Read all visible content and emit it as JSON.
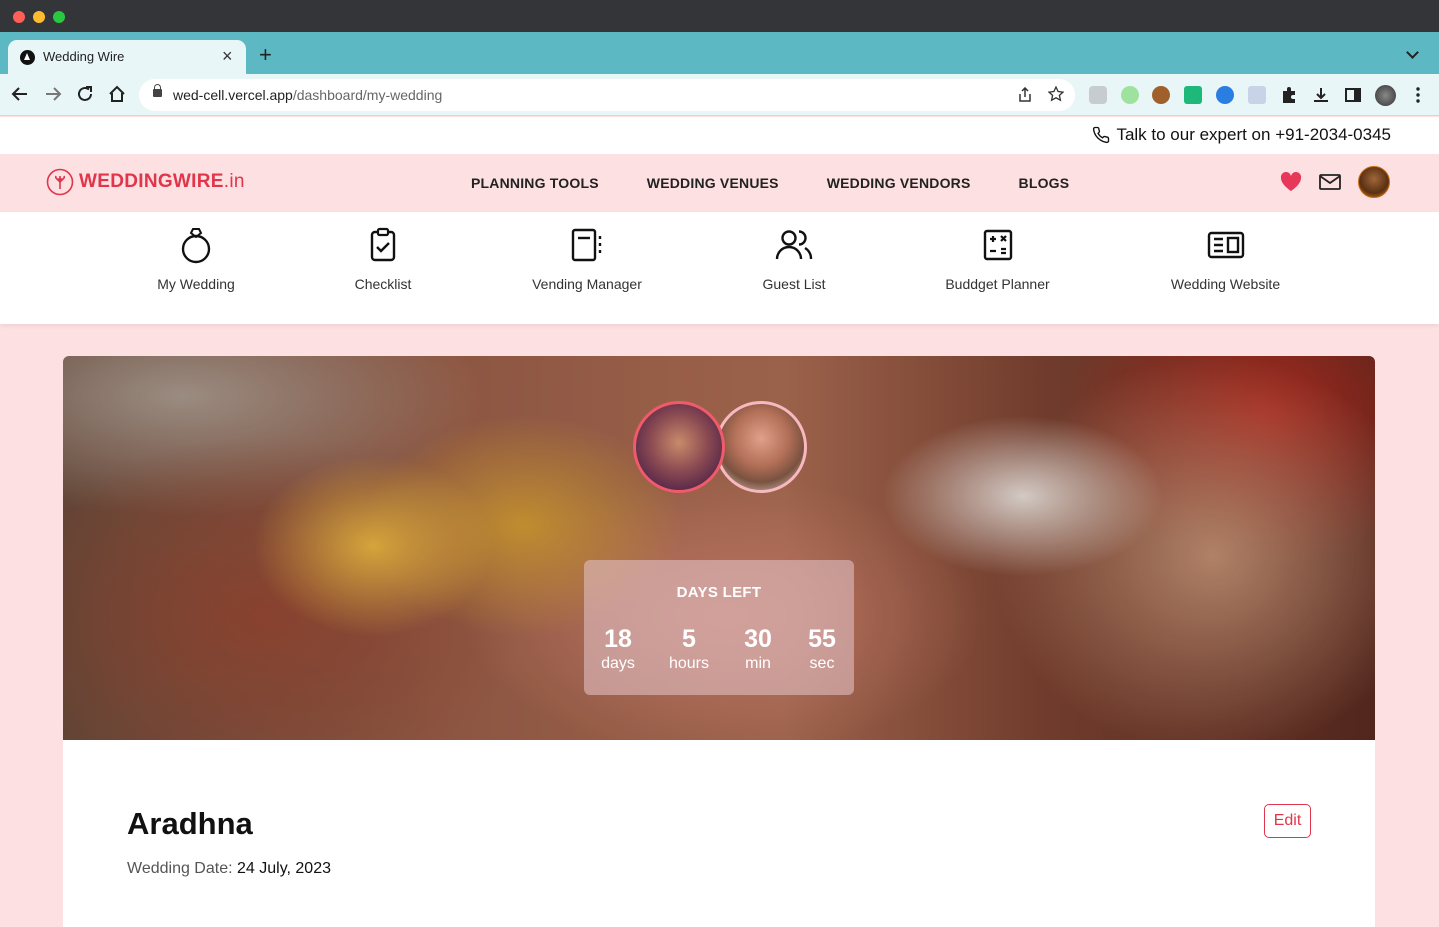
{
  "browser": {
    "tab_title": "Wedding Wire",
    "url_host": "wed-cell.vercel.app",
    "url_path": "/dashboard/my-wedding"
  },
  "contact": {
    "text": "Talk to our expert on ",
    "phone": "+91-2034-0345"
  },
  "brand": {
    "name_bold": "WEDDINGWIRE",
    "name_suffix": ".in",
    "accent_color": "#e0354b",
    "background_color": "#fde0e1"
  },
  "nav": {
    "links": [
      "PLANNING TOOLS",
      "WEDDING VENUES",
      "WEDDING VENDORS",
      "BLOGS"
    ],
    "icons": [
      "heart-icon",
      "mail-icon",
      "user-avatar"
    ]
  },
  "tools": [
    {
      "label": "My Wedding",
      "icon": "ring-icon"
    },
    {
      "label": "Checklist",
      "icon": "clipboard-check-icon"
    },
    {
      "label": "Vending Manager",
      "icon": "notebook-icon"
    },
    {
      "label": "Guest List",
      "icon": "users-icon"
    },
    {
      "label": "Buddget Planner",
      "icon": "calculator-icon"
    },
    {
      "label": "Wedding Website",
      "icon": "website-layout-icon"
    }
  ],
  "countdown": {
    "title": "DAYS LEFT",
    "days": "18",
    "days_label": "days",
    "hours": "5",
    "hours_label": "hours",
    "minutes": "30",
    "minutes_label": "min",
    "seconds": "55",
    "seconds_label": "sec"
  },
  "wedding": {
    "name": "Aradhna",
    "date_label": "Wedding Date: ",
    "date_value": "24 July, 2023",
    "edit_label": "Edit"
  }
}
